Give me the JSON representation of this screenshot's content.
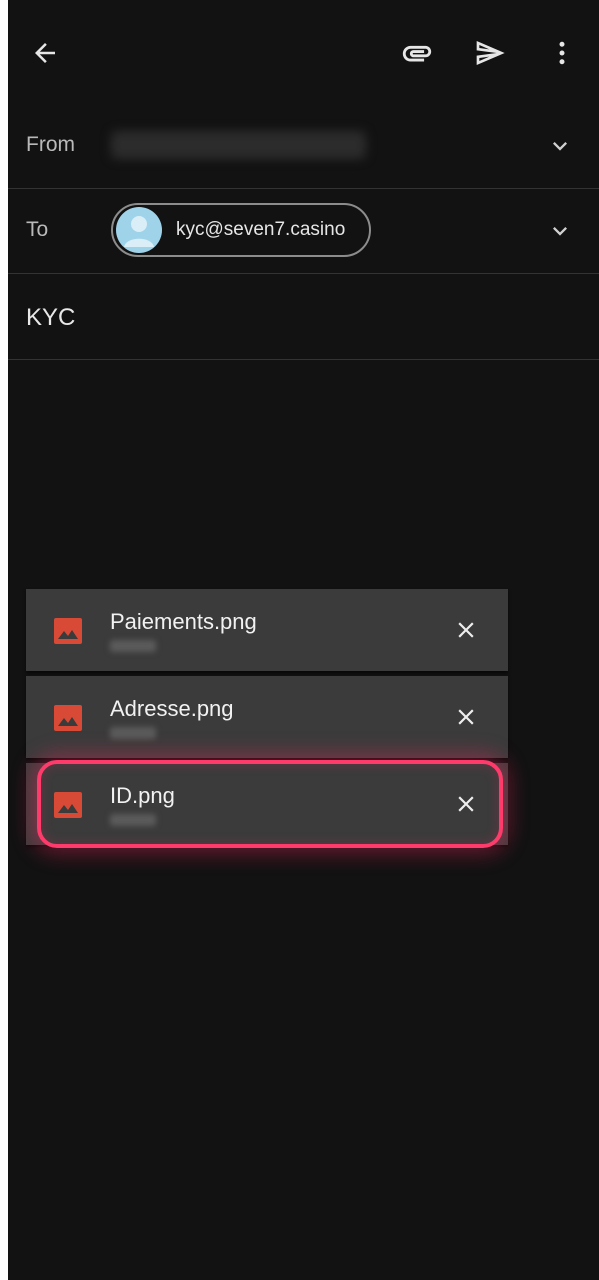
{
  "appbar": {
    "back_icon": "arrow-left-icon",
    "attach_icon": "paperclip-icon",
    "send_icon": "send-icon",
    "more_icon": "more-vertical-icon"
  },
  "compose": {
    "from_label": "From",
    "to_label": "To",
    "to_chip": {
      "email": "kyc@seven7.casino",
      "avatar_icon": "person-avatar-icon"
    },
    "subject": "KYC"
  },
  "attachments": [
    {
      "name": "Paiements.png",
      "icon": "image-file-icon",
      "remove_icon": "close-icon"
    },
    {
      "name": "Adresse.png",
      "icon": "image-file-icon",
      "remove_icon": "close-icon"
    },
    {
      "name": "ID.png",
      "icon": "image-file-icon",
      "remove_icon": "close-icon",
      "highlighted": true
    }
  ],
  "colors": {
    "background": "#121212",
    "attachment_bg": "#3b3b3b",
    "highlight": "#ff3b6b",
    "file_icon": "#d84a36",
    "avatar_bg": "#9fd3ea"
  }
}
